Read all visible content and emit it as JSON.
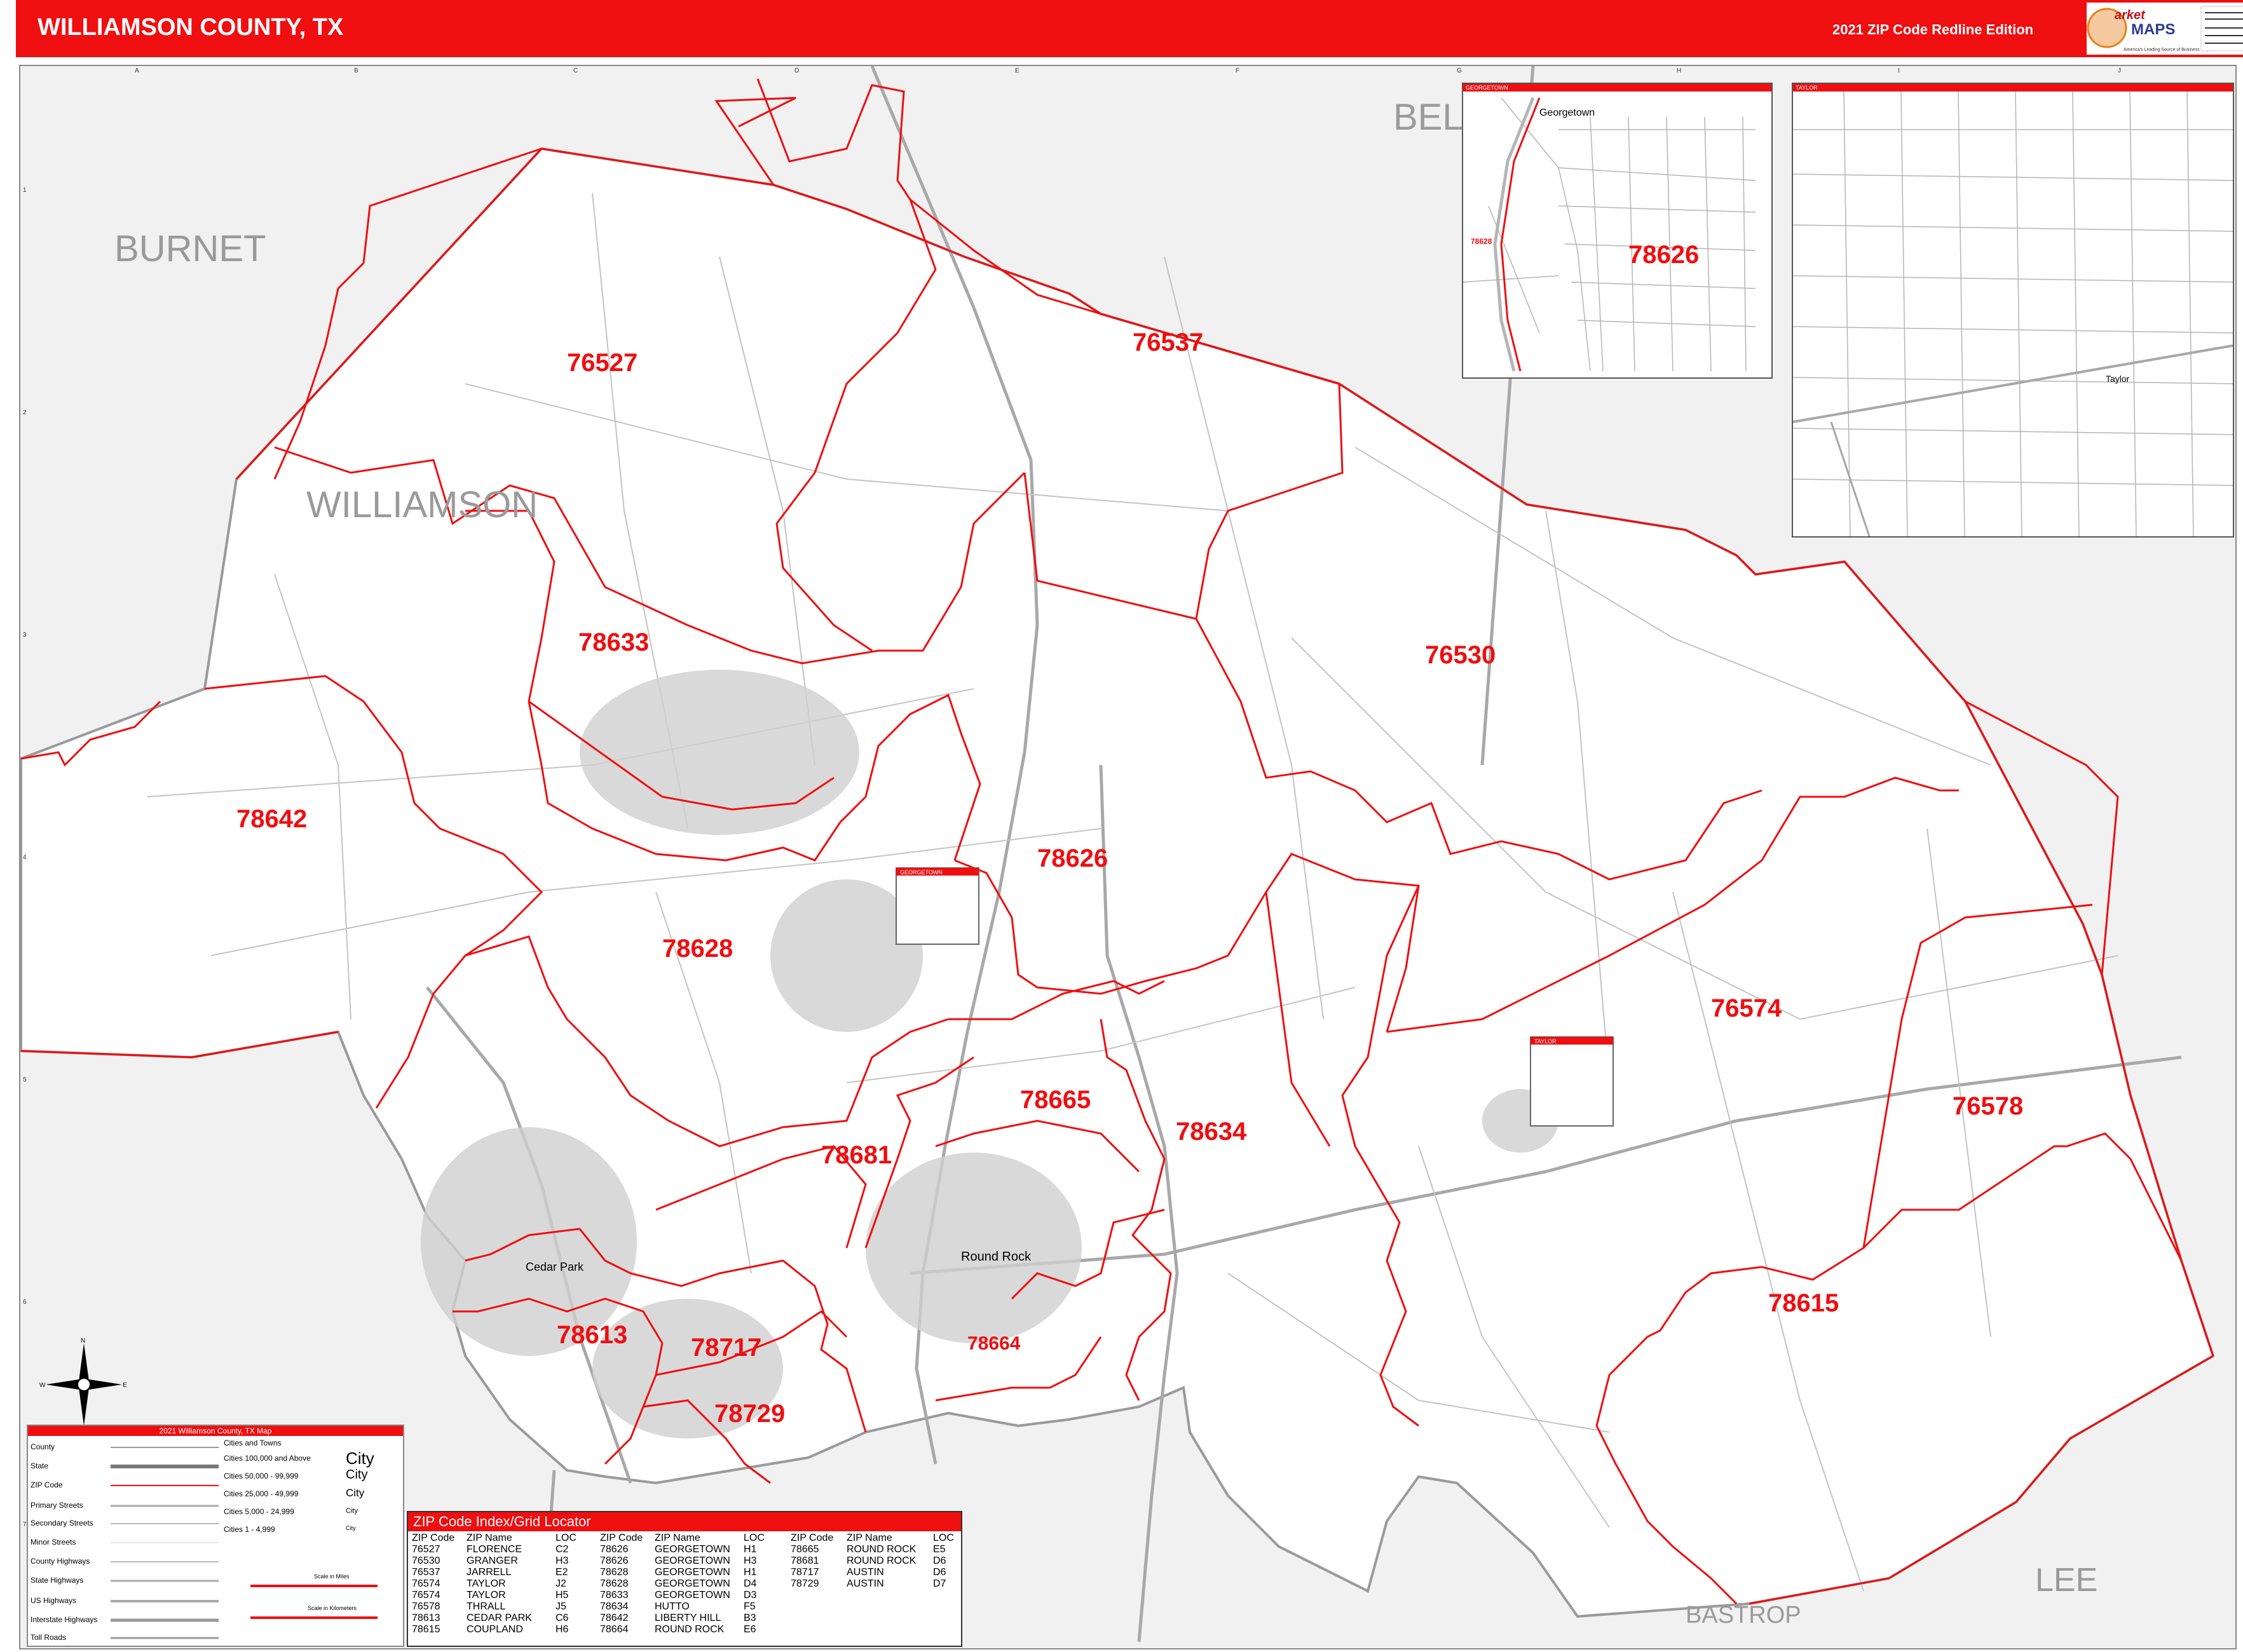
{
  "header": {
    "title": "WILLIAMSON COUNTY, TX",
    "edition": "2021 ZIP Code Redline Edition",
    "logo_name": "Market MAPS",
    "logo_tagline": "America's Leading Source of Business Maps"
  },
  "colors": {
    "accent": "#ef0e10",
    "county_fill": "#ffffff",
    "outside_fill": "#f1f1f1",
    "road": "#9a9a9a",
    "label_gray": "#9a9a9a"
  },
  "grid": {
    "letters": [
      "A",
      "B",
      "C",
      "D",
      "E",
      "F",
      "G",
      "H",
      "I",
      "J"
    ],
    "numbers": [
      "1",
      "2",
      "3",
      "4",
      "5",
      "6",
      "7"
    ]
  },
  "counties": {
    "burnet": "BURNET",
    "williamson": "WILLIAMSON",
    "bell": "BEL",
    "bastrop": "BASTROP",
    "lee": "LEE"
  },
  "zip_labels": {
    "z76527": "76527",
    "z76537": "76537",
    "z78633": "78633",
    "z76530": "76530",
    "z78642": "78642",
    "z78626": "78626",
    "z78628": "78628",
    "z76574": "76574",
    "z78665": "78665",
    "z78634": "78634",
    "z76578": "76578",
    "z78681": "78681",
    "z78615": "78615",
    "z78613": "78613",
    "z78717": "78717",
    "z78664": "78664",
    "z78729": "78729"
  },
  "cities": {
    "round_rock": "Round Rock",
    "cedar_park": "Cedar Park"
  },
  "insets": {
    "georgetown": {
      "title": "GEORGETOWN",
      "city": "Georgetown",
      "zip": "78626",
      "zip_small": "78628"
    },
    "taylor": {
      "title": "TAYLOR",
      "city": "Taylor"
    }
  },
  "locator_boxes": {
    "georgetown": "GEORGETOWN",
    "taylor": "TAYLOR"
  },
  "legend": {
    "title": "2021 Williamson County, TX Map",
    "rows": [
      "County",
      "State",
      "ZIP Code",
      "Primary Streets",
      "Secondary Streets",
      "Minor Streets",
      "County Highways",
      "State Highways",
      "US Highways",
      "Interstate Highways",
      "Toll Roads"
    ],
    "cities_header": "Cities and Towns",
    "city_classes": [
      "Cities 100,000 and Above",
      "Cities 50,000 - 99,999",
      "Cities 25,000 - 49,999",
      "Cities 5,000 - 24,999",
      "Cities 1 - 4,999"
    ],
    "city_samples": [
      "City",
      "City",
      "City",
      "City",
      "City"
    ],
    "scale_miles": "Scale in Miles",
    "scale_km": "Scale in Kilometers"
  },
  "zip_index": {
    "title": "ZIP Code Index/Grid Locator",
    "headers": [
      "ZIP Code",
      "ZIP Name",
      "LOC"
    ],
    "columns": [
      [
        [
          "76527",
          "FLORENCE",
          "C2"
        ],
        [
          "76530",
          "GRANGER",
          "H3"
        ],
        [
          "76537",
          "JARRELL",
          "E2"
        ],
        [
          "76574",
          "TAYLOR",
          "J2"
        ],
        [
          "76574",
          "TAYLOR",
          "H5"
        ],
        [
          "76578",
          "THRALL",
          "J5"
        ],
        [
          "78613",
          "CEDAR PARK",
          "C6"
        ],
        [
          "78615",
          "COUPLAND",
          "H6"
        ]
      ],
      [
        [
          "78626",
          "GEORGETOWN",
          "H1"
        ],
        [
          "78626",
          "GEORGETOWN",
          "H3"
        ],
        [
          "78628",
          "GEORGETOWN",
          "H1"
        ],
        [
          "78628",
          "GEORGETOWN",
          "D4"
        ],
        [
          "78633",
          "GEORGETOWN",
          "D3"
        ],
        [
          "78634",
          "HUTTO",
          "F5"
        ],
        [
          "78642",
          "LIBERTY HILL",
          "B3"
        ],
        [
          "78664",
          "ROUND ROCK",
          "E6"
        ]
      ],
      [
        [
          "78665",
          "ROUND ROCK",
          "E5"
        ],
        [
          "78681",
          "ROUND ROCK",
          "D6"
        ],
        [
          "78717",
          "AUSTIN",
          "D6"
        ],
        [
          "78729",
          "AUSTIN",
          "D7"
        ]
      ]
    ]
  }
}
